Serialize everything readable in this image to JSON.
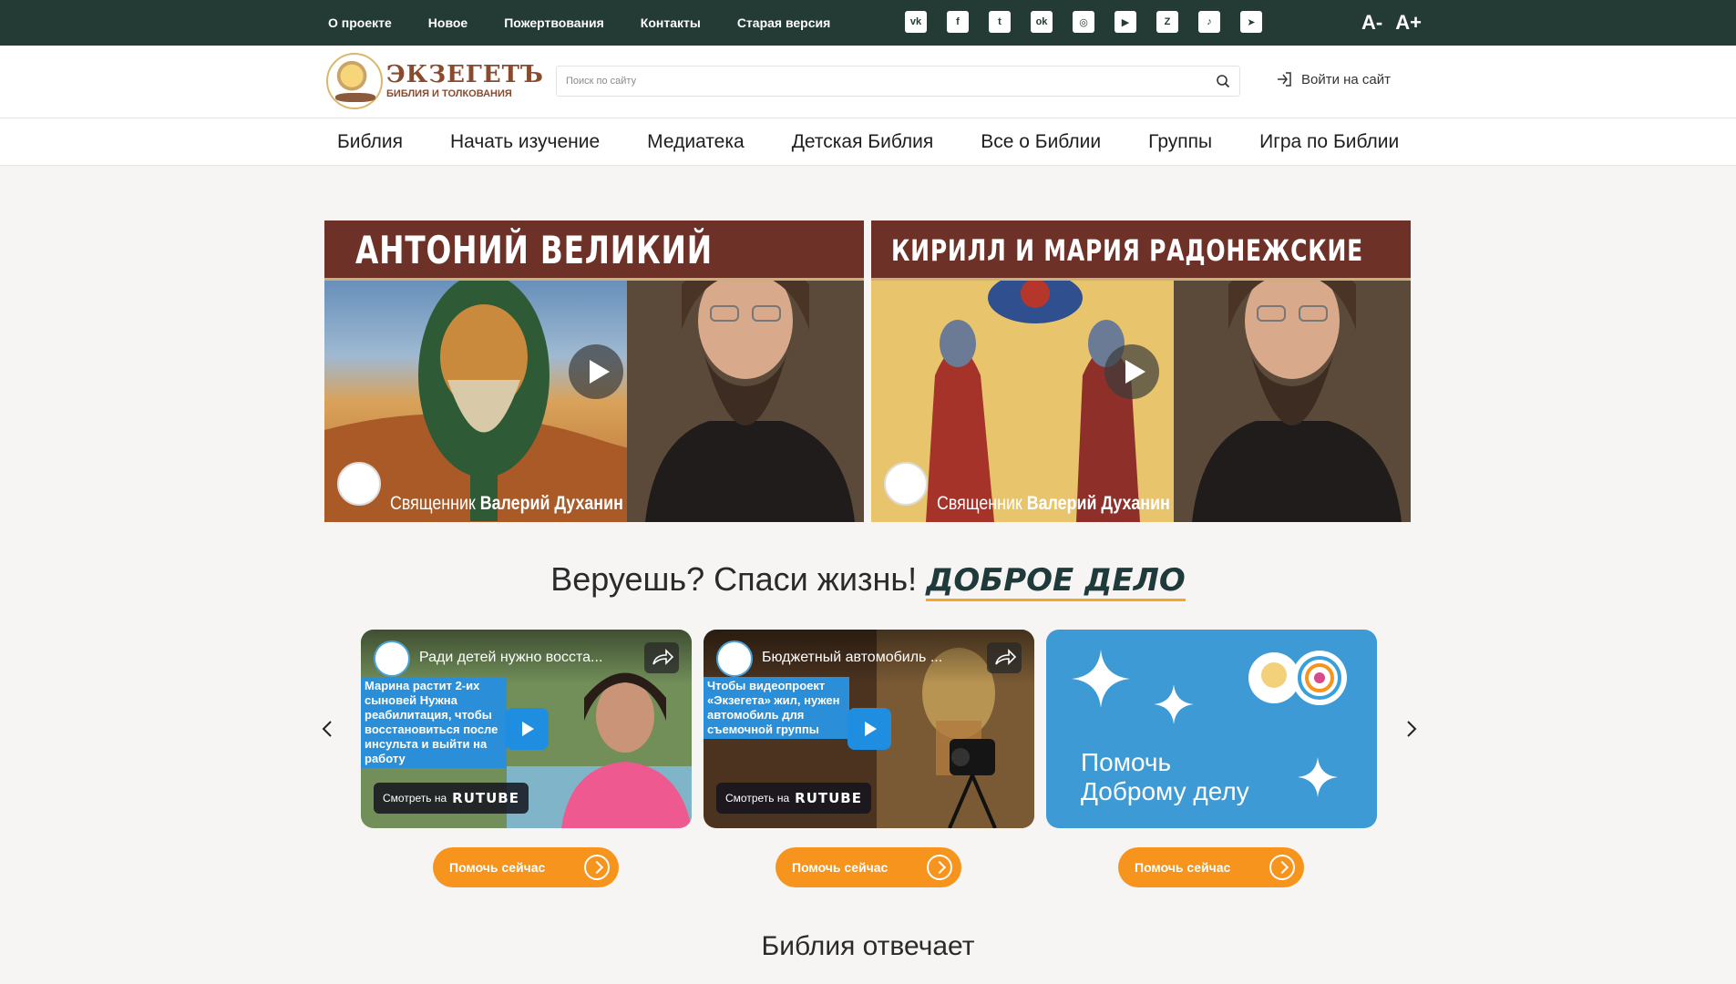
{
  "topbar": {
    "links": [
      "О проекте",
      "Новое",
      "Пожертвования",
      "Контакты",
      "Старая версия"
    ],
    "socials": [
      {
        "icon": "vk-icon",
        "glyph": "vk"
      },
      {
        "icon": "facebook-icon",
        "glyph": "f"
      },
      {
        "icon": "twitter-icon",
        "glyph": "t"
      },
      {
        "icon": "odnoklassniki-icon",
        "glyph": "ok"
      },
      {
        "icon": "instagram-icon",
        "glyph": "◎"
      },
      {
        "icon": "youtube-icon",
        "glyph": "▶"
      },
      {
        "icon": "zen-icon",
        "glyph": "Z"
      },
      {
        "icon": "tiktok-icon",
        "glyph": "♪"
      },
      {
        "icon": "telegram-icon",
        "glyph": "➤"
      }
    ],
    "font_decrease": "A-",
    "font_increase": "A+",
    "bg_color": "#243a35"
  },
  "header": {
    "logo_title": "ЭКЗЕГЕТЪ",
    "logo_subtitle": "БИБЛИЯ И ТОЛКОВАНИЯ",
    "search_placeholder": "Поиск по сайту",
    "login_label": "Войти на сайт"
  },
  "mainnav": {
    "items": [
      "Библия",
      "Начать изучение",
      "Медиатека",
      "Детская Библия",
      "Все о Библии",
      "Группы",
      "Игра по Библии"
    ]
  },
  "hero": {
    "videos": [
      {
        "title": "АНТОНИЙ ВЕЛИКИЙ",
        "caption_prefix": "Священник",
        "caption_name": "Валерий Духанин"
      },
      {
        "title": "КИРИЛЛ И МАРИЯ РАДОНЕЖСКИЕ",
        "caption_prefix": "Священник",
        "caption_name": "Валерий Духанин"
      }
    ]
  },
  "promo": {
    "heading": "Веруешь? Спаси жизнь!",
    "accent": "ДОБРОЕ ДЕЛО",
    "accent_color": "#1f3a3a",
    "underline_color": "#f5a623"
  },
  "carousel": {
    "cards": [
      {
        "title": "Ради детей нужно восста...",
        "text": "Марина растит 2-их сыновей Нужна реабилитация, чтобы восстановиться после инсульта и выйти на работу",
        "watch_prefix": "Смотреть на",
        "watch_brand": "RUTUBE"
      },
      {
        "title": "Бюджетный автомобиль ...",
        "text": "Чтобы видеопроект «Экзегета» жил, нужен автомобиль для съемочной группы",
        "watch_prefix": "Смотреть на",
        "watch_brand": "RUTUBE"
      },
      {
        "help_text_1": "Помочь",
        "help_text_2": "Доброму делу"
      }
    ],
    "button_label": "Помочь сейчас",
    "button_color": "#f7941d"
  },
  "section": {
    "title": "Библия отвечает"
  }
}
